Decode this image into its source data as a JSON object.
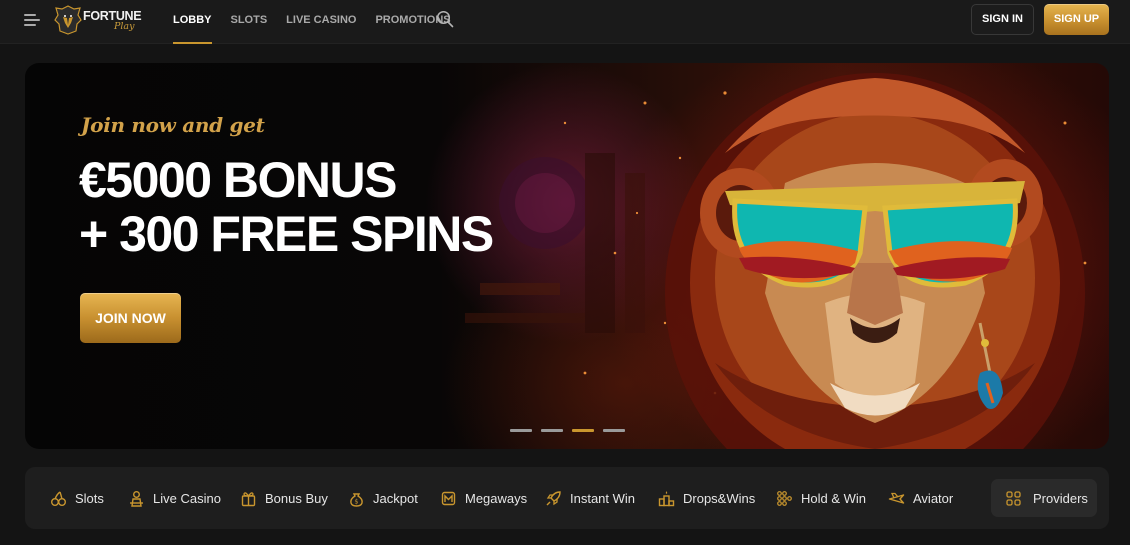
{
  "header": {
    "logo": {
      "line1": "FORTUNE",
      "line2": "Play"
    },
    "nav": [
      "LOBBY",
      "SLOTS",
      "LIVE CASINO",
      "PROMOTIONS"
    ],
    "active_nav": "LOBBY",
    "sign_in": "SIGN IN",
    "sign_up": "SIGN UP"
  },
  "hero": {
    "eyebrow": "Join now and get",
    "line1": "€5000 BONUS",
    "line2": "+ 300 FREE SPINS",
    "cta": "JOIN NOW",
    "slides_count": 4,
    "active_slide": 3
  },
  "categories": [
    {
      "label": "Slots",
      "icon": "cherries-icon"
    },
    {
      "label": "Live Casino",
      "icon": "dealer-icon"
    },
    {
      "label": "Bonus Buy",
      "icon": "gift-icon"
    },
    {
      "label": "Jackpot",
      "icon": "money-bag-icon"
    },
    {
      "label": "Megaways",
      "icon": "megaways-icon"
    },
    {
      "label": "Instant Win",
      "icon": "rocket-icon"
    },
    {
      "label": "Drops&Wins",
      "icon": "podium-icon"
    },
    {
      "label": "Hold & Win",
      "icon": "grid-dots-icon"
    },
    {
      "label": "Aviator",
      "icon": "plane-icon"
    }
  ],
  "providers_label": "Providers",
  "colors": {
    "accent_gold": "#c9962e",
    "background": "#141414",
    "panel": "#1e1e1e"
  }
}
